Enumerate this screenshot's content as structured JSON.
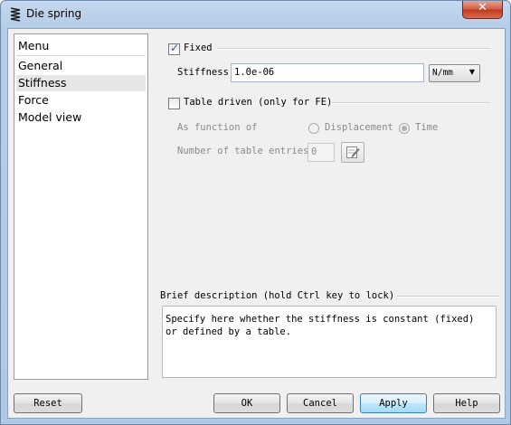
{
  "window": {
    "title": "Die spring"
  },
  "menu": {
    "header": "Menu",
    "items": [
      {
        "label": "General",
        "selected": false
      },
      {
        "label": "Stiffness",
        "selected": true
      },
      {
        "label": "Force",
        "selected": false
      },
      {
        "label": "Model view",
        "selected": false
      }
    ]
  },
  "fixed": {
    "label": "Fixed",
    "checked": true,
    "stiffness_label": "Stiffness",
    "stiffness_value": "1.0e-06",
    "unit": "N/mm"
  },
  "table": {
    "label": "Table driven (only for FE)",
    "checked": false,
    "function_label": "As function of",
    "options": [
      "Displacement",
      "Time"
    ],
    "selected_option": "Time",
    "entries_label": "Number of table entries",
    "entries_value": "0"
  },
  "description": {
    "heading": "Brief description (hold Ctrl key to lock)",
    "text": "Specify here whether the stiffness is constant (fixed) or defined by a table."
  },
  "buttons": {
    "reset": "Reset",
    "ok": "OK",
    "cancel": "Cancel",
    "apply": "Apply",
    "help": "Help"
  },
  "icons": {
    "app": "spring-icon",
    "close": "close-icon",
    "edit": "edit-icon",
    "dropdown": "chevron-down-icon"
  }
}
